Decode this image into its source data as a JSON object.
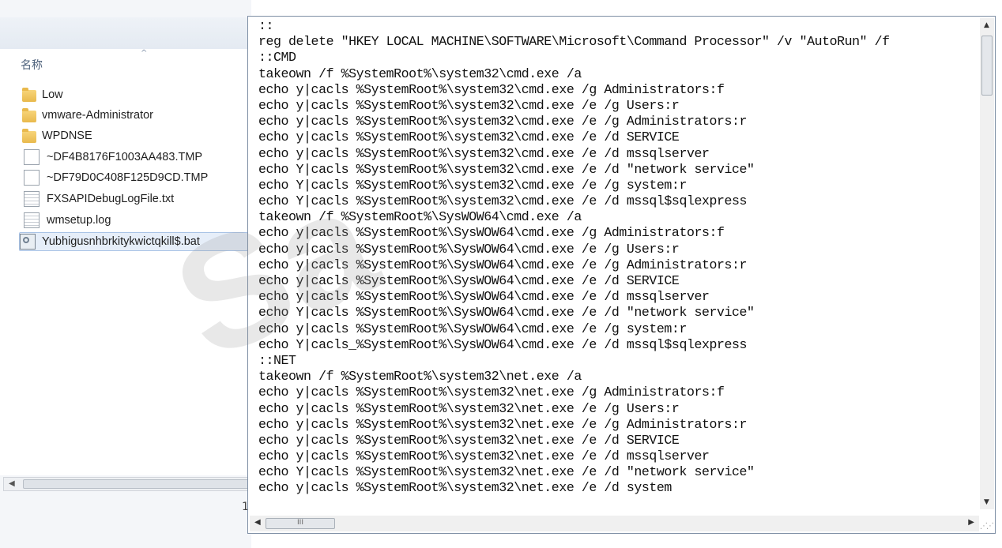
{
  "explorer": {
    "column_header": "名称",
    "files": [
      {
        "name": "Low",
        "icon": "folder-icon"
      },
      {
        "name": "vmware-Administrator",
        "icon": "folder-icon"
      },
      {
        "name": "WPDNSE",
        "icon": "folder-icon"
      },
      {
        "name": "~DF4B8176F1003AA483.TMP",
        "icon": "file-icon"
      },
      {
        "name": "~DF79D0C408F125D9CD.TMP",
        "icon": "file-icon"
      },
      {
        "name": "FXSAPIDebugLogFile.txt",
        "icon": "text-file-icon"
      },
      {
        "name": "wmsetup.log",
        "icon": "text-file-icon"
      },
      {
        "name": "Yubhigusnhbrkitykwictqkill$.bat",
        "icon": "batch-file-icon",
        "selected": true
      }
    ],
    "stray_text": "1"
  },
  "notepad": {
    "lines": [
      "::",
      "reg delete \"HKEY LOCAL MACHINE\\SOFTWARE\\Microsoft\\Command Processor\" /v \"AutoRun\" /f",
      "::CMD",
      "takeown /f %SystemRoot%\\system32\\cmd.exe /a",
      "echo y|cacls %SystemRoot%\\system32\\cmd.exe /g Administrators:f",
      "echo y|cacls %SystemRoot%\\system32\\cmd.exe /e /g Users:r",
      "echo y|cacls %SystemRoot%\\system32\\cmd.exe /e /g Administrators:r",
      "echo y|cacls %SystemRoot%\\system32\\cmd.exe /e /d SERVICE",
      "echo y|cacls %SystemRoot%\\system32\\cmd.exe /e /d mssqlserver",
      "echo Y|cacls %SystemRoot%\\system32\\cmd.exe /e /d \"network service\"",
      "echo Y|cacls %SystemRoot%\\system32\\cmd.exe /e /g system:r",
      "echo Y|cacls %SystemRoot%\\system32\\cmd.exe /e /d mssql$sqlexpress",
      "takeown /f %SystemRoot%\\SysWOW64\\cmd.exe /a",
      "echo y|cacls %SystemRoot%\\SysWOW64\\cmd.exe /g Administrators:f",
      "echo y|cacls %SystemRoot%\\SysWOW64\\cmd.exe /e /g Users:r",
      "echo y|cacls %SystemRoot%\\SysWOW64\\cmd.exe /e /g Administrators:r",
      "echo y|cacls %SystemRoot%\\SysWOW64\\cmd.exe /e /d SERVICE",
      "echo y|cacls %SystemRoot%\\SysWOW64\\cmd.exe /e /d mssqlserver",
      "echo Y|cacls %SystemRoot%\\SysWOW64\\cmd.exe /e /d \"network service\"",
      "echo y|cacls %SystemRoot%\\SysWOW64\\cmd.exe /e /g system:r",
      "echo Y|cacls_%SystemRoot%\\SysWOW64\\cmd.exe /e /d mssql$sqlexpress",
      "::NET",
      "takeown /f %SystemRoot%\\system32\\net.exe /a",
      "echo y|cacls %SystemRoot%\\system32\\net.exe /g Administrators:f",
      "echo y|cacls %SystemRoot%\\system32\\net.exe /e /g Users:r",
      "echo y|cacls %SystemRoot%\\system32\\net.exe /e /g Administrators:r",
      "echo y|cacls %SystemRoot%\\system32\\net.exe /e /d SERVICE",
      "echo y|cacls %SystemRoot%\\system32\\net.exe /e /d mssqlserver",
      "echo Y|cacls %SystemRoot%\\system32\\net.exe /e /d \"network service\"",
      "echo y|cacls %SystemRoot%\\system32\\net.exe /e /d system"
    ],
    "hscroll_thumb_label": "III"
  },
  "watermark": "Sa",
  "colors": {
    "selection_bg": "#e6eef9",
    "selection_border": "#a9c3e6",
    "window_border": "#7d8ea4"
  }
}
